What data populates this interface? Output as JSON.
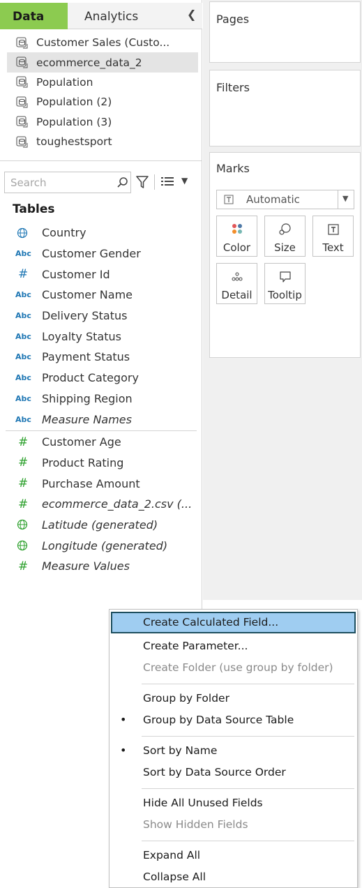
{
  "tabs": {
    "data": "Data",
    "analytics": "Analytics"
  },
  "datasources": [
    {
      "label": "Customer Sales (Custo...",
      "selected": false
    },
    {
      "label": "ecommerce_data_2",
      "selected": true
    },
    {
      "label": "Population",
      "selected": false
    },
    {
      "label": "Population (2)",
      "selected": false
    },
    {
      "label": "Population (3)",
      "selected": false
    },
    {
      "label": "toughestsport",
      "selected": false
    }
  ],
  "search": {
    "placeholder": "Search"
  },
  "tables_header": "Tables",
  "dimension_type_abc": "Abc",
  "fields": [
    {
      "label": "Country",
      "type": "globe-blue"
    },
    {
      "label": "Customer Gender",
      "type": "abc"
    },
    {
      "label": "Customer Id",
      "type": "hash-blue"
    },
    {
      "label": "Customer Name",
      "type": "abc"
    },
    {
      "label": "Delivery Status",
      "type": "abc"
    },
    {
      "label": "Loyalty Status",
      "type": "abc"
    },
    {
      "label": "Payment Status",
      "type": "abc"
    },
    {
      "label": "Product Category",
      "type": "abc"
    },
    {
      "label": "Shipping Region",
      "type": "abc"
    },
    {
      "label": "Measure Names",
      "type": "abc"
    },
    {
      "label": "Customer Age",
      "type": "hash-green"
    },
    {
      "label": "Product Rating",
      "type": "hash-green"
    },
    {
      "label": "Purchase Amount",
      "type": "hash-green"
    },
    {
      "label": "ecommerce_data_2.csv (...",
      "type": "hash-green"
    },
    {
      "label": "Latitude (generated)",
      "type": "globe-green"
    },
    {
      "label": "Longitude (generated)",
      "type": "globe-green"
    },
    {
      "label": "Measure Values",
      "type": "hash-green"
    }
  ],
  "cards": {
    "pages": "Pages",
    "filters": "Filters",
    "marks": "Marks"
  },
  "marks": {
    "type_dropdown": "Automatic",
    "buttons": {
      "color": "Color",
      "size": "Size",
      "text": "Text",
      "detail": "Detail",
      "tooltip": "Tooltip"
    }
  },
  "context_menu": {
    "create_calculated_field": "Create Calculated Field...",
    "create_parameter": "Create Parameter...",
    "create_folder": "Create Folder (use group by folder)",
    "group_by_folder": "Group by Folder",
    "group_by_data_source_table": "Group by Data Source Table",
    "sort_by_name": "Sort by Name",
    "sort_by_data_source_order": "Sort by Data Source Order",
    "hide_all_unused_fields": "Hide All Unused Fields",
    "show_hidden_fields": "Show Hidden Fields",
    "expand_all": "Expand All",
    "collapse_all": "Collapse All",
    "bullet": "•"
  },
  "colors": {
    "data_tab": "#8ccb50",
    "menu_highlight": "#9fcdf1",
    "dimension_blue": "#1f77b4",
    "measure_green": "#2ca02c"
  }
}
